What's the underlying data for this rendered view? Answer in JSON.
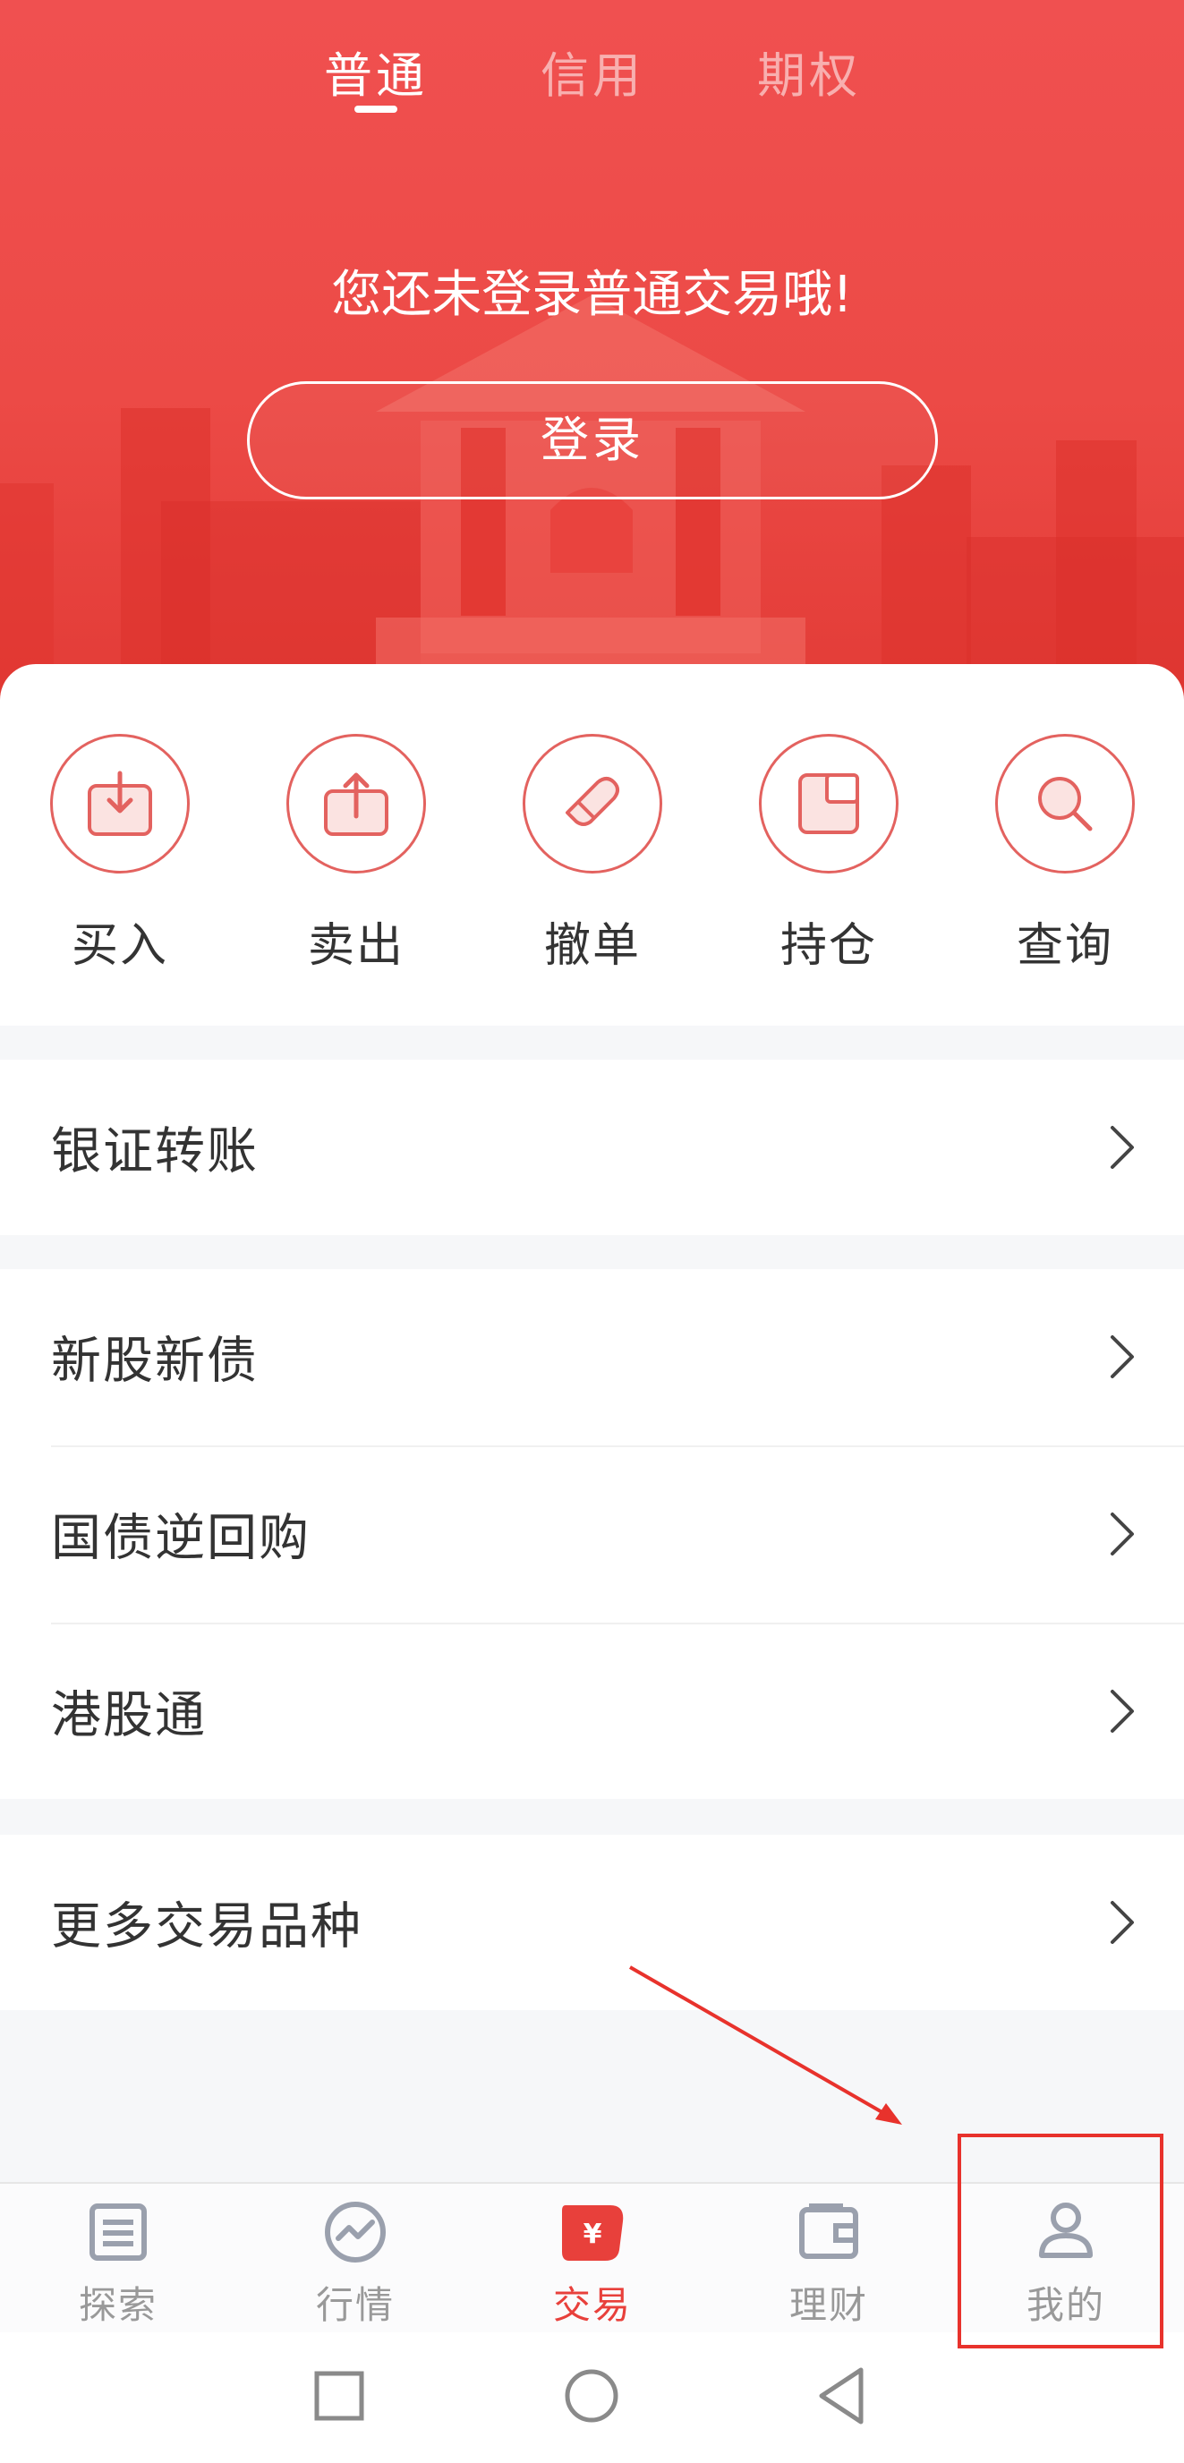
{
  "header": {
    "tabs": [
      {
        "label": "普通",
        "active": true
      },
      {
        "label": "信用",
        "active": false
      },
      {
        "label": "期权",
        "active": false
      }
    ],
    "prompt": "您还未登录普通交易哦!",
    "login_label": "登录"
  },
  "quick_actions": [
    {
      "label": "买入",
      "icon": "buy-icon"
    },
    {
      "label": "卖出",
      "icon": "sell-icon"
    },
    {
      "label": "撤单",
      "icon": "cancel-order-icon"
    },
    {
      "label": "持仓",
      "icon": "holdings-icon"
    },
    {
      "label": "查询",
      "icon": "search-icon"
    }
  ],
  "menu": {
    "bank_transfer": "银证转账",
    "new_stock_bond": "新股新债",
    "treasury_repo": "国债逆回购",
    "hk_connect": "港股通",
    "more_products": "更多交易品种"
  },
  "bottom_nav": [
    {
      "label": "探索",
      "icon": "explore-icon",
      "active": false
    },
    {
      "label": "行情",
      "icon": "market-icon",
      "active": false
    },
    {
      "label": "交易",
      "icon": "trade-icon",
      "active": true
    },
    {
      "label": "理财",
      "icon": "wallet-icon",
      "active": false
    },
    {
      "label": "我的",
      "icon": "profile-icon",
      "active": false
    }
  ],
  "colors": {
    "accent": "#e8403b",
    "header_top": "#f05050",
    "annotation": "#e8322c"
  }
}
